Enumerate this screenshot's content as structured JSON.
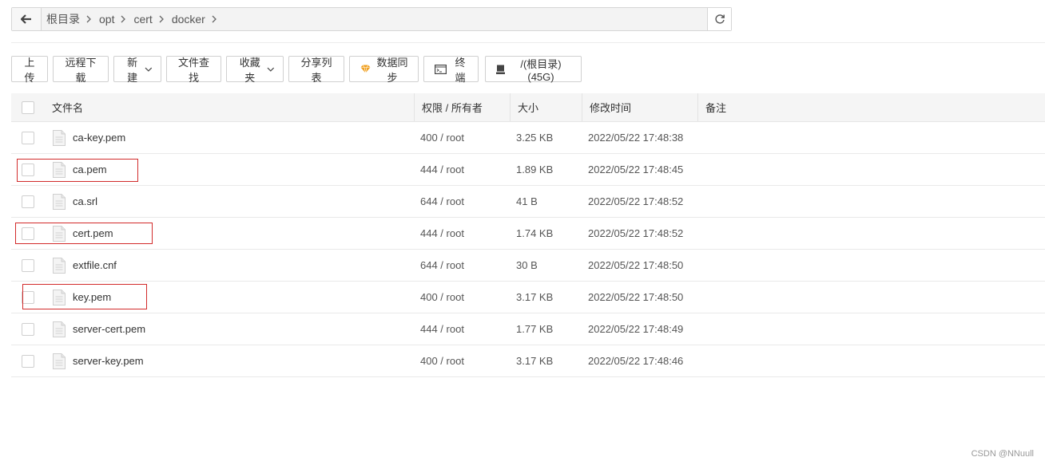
{
  "path": {
    "crumbs": [
      "根目录",
      "opt",
      "cert",
      "docker"
    ]
  },
  "toolbar": {
    "upload": "上传",
    "remote_download": "远程下载",
    "new": "新建",
    "find_file": "文件查找",
    "favorites": "收藏夹",
    "share_list": "分享列表",
    "sync": "数据同步",
    "terminal": "终端",
    "disk": "/(根目录) (45G)"
  },
  "table": {
    "headers": {
      "name": "文件名",
      "perm": "权限 / 所有者",
      "size": "大小",
      "mtime": "修改时间",
      "note": "备注"
    },
    "rows": [
      {
        "name": "ca-key.pem",
        "perm": "400 / root",
        "size": "3.25 KB",
        "mtime": "2022/05/22 17:48:38",
        "note": ""
      },
      {
        "name": "ca.pem",
        "perm": "444 / root",
        "size": "1.89 KB",
        "mtime": "2022/05/22 17:48:45",
        "note": ""
      },
      {
        "name": "ca.srl",
        "perm": "644 / root",
        "size": "41 B",
        "mtime": "2022/05/22 17:48:52",
        "note": ""
      },
      {
        "name": "cert.pem",
        "perm": "444 / root",
        "size": "1.74 KB",
        "mtime": "2022/05/22 17:48:52",
        "note": ""
      },
      {
        "name": "extfile.cnf",
        "perm": "644 / root",
        "size": "30 B",
        "mtime": "2022/05/22 17:48:50",
        "note": ""
      },
      {
        "name": "key.pem",
        "perm": "400 / root",
        "size": "3.17 KB",
        "mtime": "2022/05/22 17:48:50",
        "note": ""
      },
      {
        "name": "server-cert.pem",
        "perm": "444 / root",
        "size": "1.77 KB",
        "mtime": "2022/05/22 17:48:49",
        "note": ""
      },
      {
        "name": "server-key.pem",
        "perm": "400 / root",
        "size": "3.17 KB",
        "mtime": "2022/05/22 17:48:46",
        "note": ""
      }
    ]
  },
  "watermark": "CSDN @NNuull",
  "colors": {
    "highlight": "#d22b2b",
    "sync_icon": "#f0a020"
  }
}
